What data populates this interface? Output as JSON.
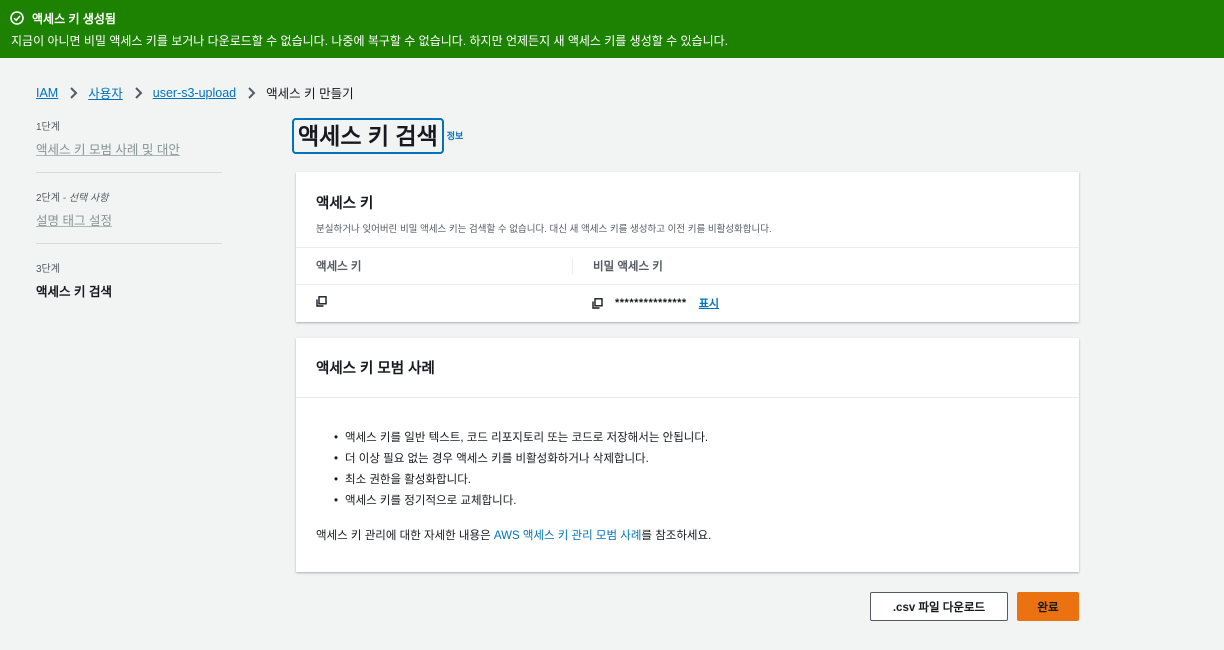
{
  "flash": {
    "title": "액세스 키 생성됨",
    "message": "지금이 아니면 비밀 액세스 키를 보거나 다운로드할 수 없습니다. 나중에 복구할 수 없습니다. 하지만 언제든지 새 액세스 키를 생성할 수 있습니다.",
    "icon": "check-circle-icon"
  },
  "breadcrumb": {
    "items": [
      "IAM",
      "사용자",
      "user-s3-upload"
    ],
    "current": "액세스 키 만들기"
  },
  "steps": [
    {
      "num": "1단계",
      "title": "액세스 키 모범 사례 및 대안"
    },
    {
      "num": "2단계",
      "optional": "- 선택 사항",
      "title": "설명 태그 설정"
    },
    {
      "num": "3단계",
      "title": "액세스 키 검색"
    }
  ],
  "page": {
    "title": "액세스 키 검색",
    "info": "정보"
  },
  "access_key_card": {
    "heading": "액세스 키",
    "description": "분실하거나 잊어버린 비밀 액세스 키는 검색할 수 없습니다. 대신 새 액세스 키를 생성하고 이전 키를 비활성화합니다.",
    "columns": [
      "액세스 키",
      "비밀 액세스 키"
    ],
    "access_key_value": "",
    "secret_masked": "***************",
    "show_label": "표시"
  },
  "best_practices": {
    "heading": "액세스 키 모범 사례",
    "items": [
      "액세스 키를 일반 텍스트, 코드 리포지토리 또는 코드로 저장해서는 안됩니다.",
      "더 이상 필요 없는 경우 액세스 키를 비활성화하거나 삭제합니다.",
      "최소 권한을 활성화합니다.",
      "액세스 키를 정기적으로 교체합니다."
    ],
    "footer_prefix": "액세스 키 관리에 대한 자세한 내용은 ",
    "footer_link": "AWS 액세스 키 관리 모범 사례",
    "footer_suffix": "를 참조하세요."
  },
  "buttons": {
    "download_csv": ".csv 파일 다운로드",
    "done": "완료"
  },
  "colors": {
    "success": "#1d8102",
    "link": "#0073bb",
    "primary": "#ec7211"
  }
}
